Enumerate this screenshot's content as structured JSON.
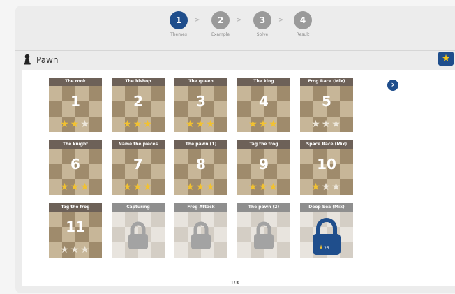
{
  "stepper": [
    {
      "num": "1",
      "label": "Themes",
      "active": true
    },
    {
      "num": "2",
      "label": "Example",
      "active": false
    },
    {
      "num": "3",
      "label": "Solve",
      "active": false
    },
    {
      "num": "4",
      "label": "Result",
      "active": false
    }
  ],
  "header": {
    "title": "Pawn",
    "icon": "chess-pawn-icon"
  },
  "badge": {
    "icon": "star-icon"
  },
  "next_icon": "chevron-right-icon",
  "colors": {
    "accent": "#1f4e8c",
    "star": "#f2c230",
    "tile_header": "#6d6158"
  },
  "levels": [
    {
      "title": "The rook",
      "number": "1",
      "stars": 2,
      "locked": false
    },
    {
      "title": "The bishop",
      "number": "2",
      "stars": 3,
      "locked": false
    },
    {
      "title": "The queen",
      "number": "3",
      "stars": 3,
      "locked": false
    },
    {
      "title": "The king",
      "number": "4",
      "stars": 3,
      "locked": false
    },
    {
      "title": "Frog Race (Mix)",
      "number": "5",
      "stars": 0,
      "locked": false
    },
    {
      "title": "The knight",
      "number": "6",
      "stars": 3,
      "locked": false
    },
    {
      "title": "Name the pieces",
      "number": "7",
      "stars": 3,
      "locked": false
    },
    {
      "title": "The pawn (1)",
      "number": "8",
      "stars": 3,
      "locked": false
    },
    {
      "title": "Tag the frog",
      "number": "9",
      "stars": 3,
      "locked": false
    },
    {
      "title": "Space Race (Mix)",
      "number": "10",
      "stars": 1,
      "locked": false
    },
    {
      "title": "Tag the frog",
      "number": "11",
      "stars": 0,
      "locked": false
    },
    {
      "title": "Capturing",
      "number": "",
      "stars": 0,
      "locked": true
    },
    {
      "title": "Frog Attack",
      "number": "",
      "stars": 0,
      "locked": true
    },
    {
      "title": "The pawn (2)",
      "number": "",
      "stars": 0,
      "locked": true
    },
    {
      "title": "Deep Sea (Mix)",
      "number": "",
      "stars": 0,
      "locked": true,
      "star_requirement": "25"
    }
  ],
  "pagination": "1/3"
}
